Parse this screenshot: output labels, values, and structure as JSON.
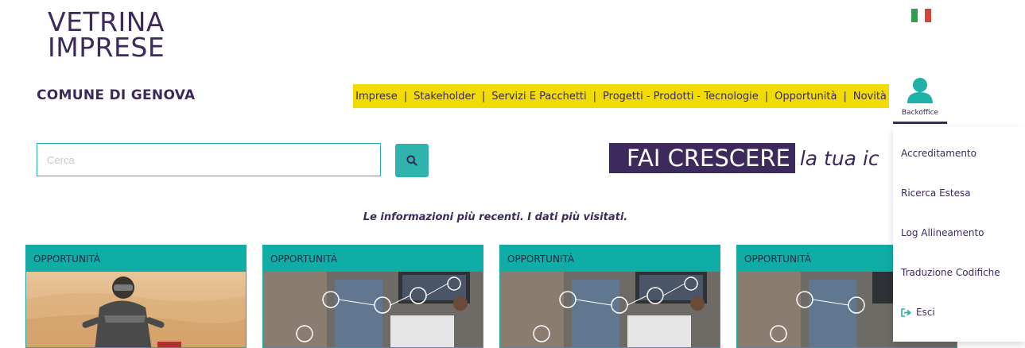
{
  "logo": {
    "line1": "VETRINA",
    "line2": "IMPRESE"
  },
  "flag": {
    "colors": [
      "#2e9e4e",
      "#ffffff",
      "#d2453b"
    ]
  },
  "comune": "COMUNE DI GENOVA",
  "nav": {
    "items": [
      "Imprese",
      "Stakeholder",
      "Servizi E Pacchetti",
      "Progetti - Prodotti - Tecnologie",
      "Opportunità",
      "Novità"
    ],
    "separator": "|"
  },
  "search": {
    "placeholder": "Cerca",
    "button_icon": "search-icon"
  },
  "hero": {
    "highlight": "FAI CRESCERE",
    "rest": "la tua ic"
  },
  "tagline": "Le informazioni più recenti. I dati più visitati.",
  "cards": [
    {
      "category": "OPPORTUNITÀ",
      "image": "motocross-rider-desert"
    },
    {
      "category": "OPPORTUNITÀ",
      "image": "business-meeting-tech"
    },
    {
      "category": "OPPORTUNITÀ",
      "image": "business-meeting-tech"
    },
    {
      "category": "OPPORTUNITÀ",
      "image": "business-meeting-tech"
    }
  ],
  "user": {
    "label": "Backoffice",
    "icon": "user-icon"
  },
  "dropdown": {
    "items": [
      "Accreditamento",
      "Ricerca Estesa",
      "Log Allineamento",
      "Traduzione Codifiche"
    ],
    "exit_label": "Esci",
    "exit_icon": "sign-out-icon"
  },
  "colors": {
    "accent": "#3d2a5c",
    "teal": "#0fada5",
    "yellow": "#f0dc00"
  }
}
